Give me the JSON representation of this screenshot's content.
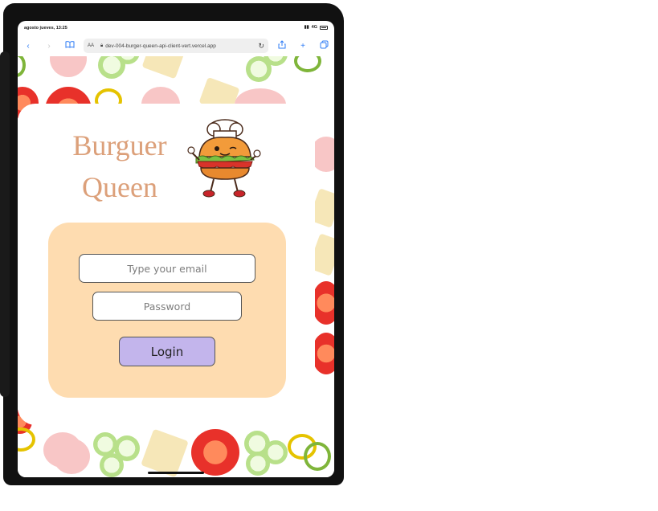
{
  "status_bar": {
    "time": "agosto jueves, 13:25",
    "network": "4G"
  },
  "browser": {
    "reader_label": "AA",
    "url": "dev-004-burger-queen-api-client-vert.vercel.app",
    "icons": [
      "back-icon",
      "forward-icon",
      "bookmarks-icon",
      "lock-icon",
      "reload-icon",
      "share-icon",
      "new-tab-icon",
      "tabs-icon"
    ]
  },
  "app": {
    "title_line1": "Burguer",
    "title_line2": "Queen",
    "title_color": "#dca07a"
  },
  "login": {
    "email_placeholder": "Type your email",
    "password_placeholder": "Password",
    "button_label": "Login",
    "panel_color": "#fedcb0",
    "button_color": "#c3b5ec"
  }
}
